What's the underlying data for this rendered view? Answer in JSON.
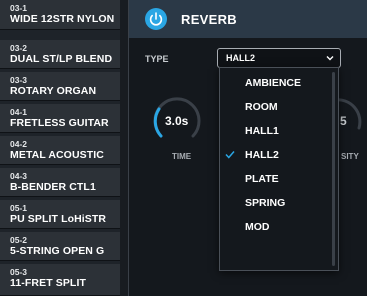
{
  "presets": [
    {
      "num": "03-1",
      "name": "WIDE 12STR NYLON"
    },
    {
      "num": "03-2",
      "name": "DUAL ST/LP BLEND"
    },
    {
      "num": "03-3",
      "name": "ROTARY ORGAN"
    },
    {
      "num": "04-1",
      "name": "FRETLESS GUITAR"
    },
    {
      "num": "04-2",
      "name": "METAL ACOUSTIC"
    },
    {
      "num": "04-3",
      "name": "B-BENDER CTL1"
    },
    {
      "num": "05-1",
      "name": "PU SPLIT LoHiSTR"
    },
    {
      "num": "05-2",
      "name": "5-STRING OPEN G"
    },
    {
      "num": "05-3",
      "name": "11-FRET SPLIT"
    }
  ],
  "effect": {
    "title": "REVERB",
    "enabled": true,
    "accent_color": "#2aa6e4",
    "power_icon": "power-icon"
  },
  "type": {
    "label": "TYPE",
    "selected": "HALL2"
  },
  "knobs": {
    "time": {
      "value": "3.0s",
      "label": "TIME"
    },
    "density": {
      "value": "5",
      "label": "SITY"
    }
  },
  "dropdown": {
    "options": [
      "AMBIENCE",
      "ROOM",
      "HALL1",
      "HALL2",
      "PLATE",
      "SPRING",
      "MOD"
    ],
    "selected": "HALL2"
  }
}
